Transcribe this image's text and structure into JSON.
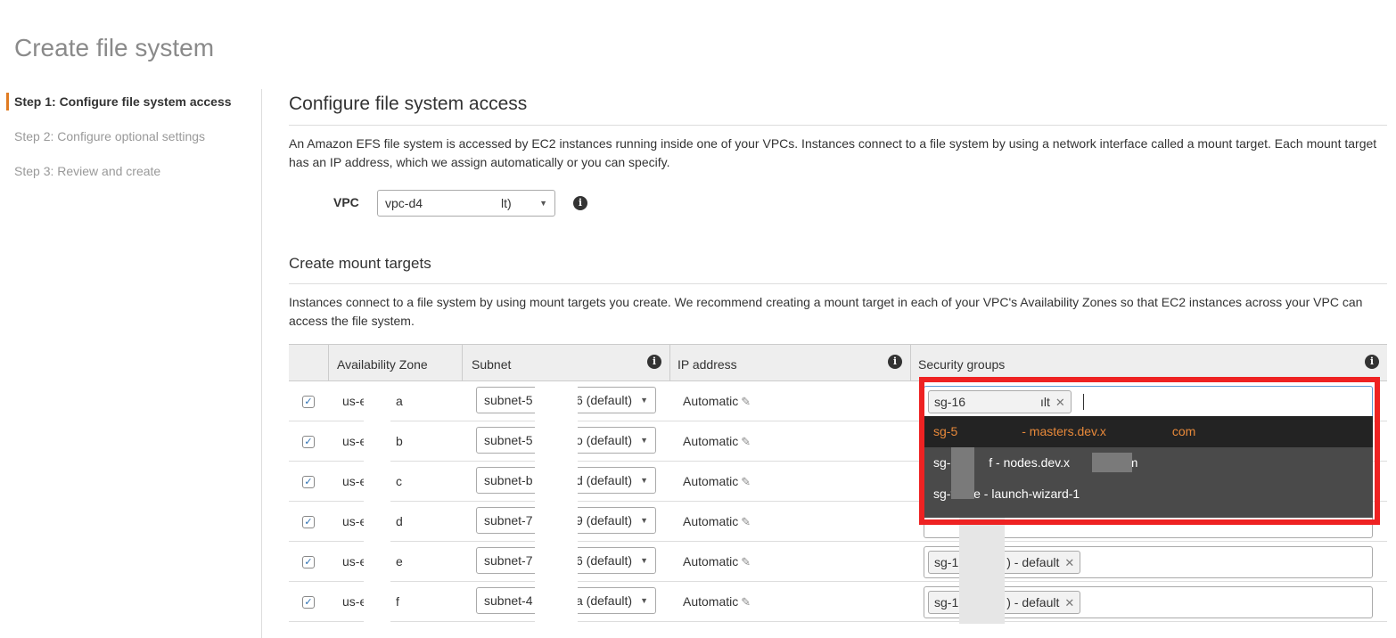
{
  "page_title": "Create file system",
  "steps": [
    {
      "label": "Step 1: Configure file system access",
      "active": true
    },
    {
      "label": "Step 2: Configure optional settings",
      "active": false
    },
    {
      "label": "Step 3: Review and create",
      "active": false
    }
  ],
  "section_title": "Configure file system access",
  "section_desc": "An Amazon EFS file system is accessed by EC2 instances running inside one of your VPCs. Instances connect to a file system by using a network interface called a mount target. Each mount target has an IP address, which we assign automatically or you can specify.",
  "vpc": {
    "label": "VPC",
    "value_start": "vpc-d4",
    "value_end": "lt)"
  },
  "mount_targets": {
    "title": "Create mount targets",
    "desc": "Instances connect to a file system by using mount targets you create. We recommend creating a mount target in each of your VPC's Availability Zones so that EC2 instances across your VPC can access the file system.",
    "columns": {
      "az": "Availability Zone",
      "subnet": "Subnet",
      "ip": "IP address",
      "sg": "Security groups"
    },
    "rows": [
      {
        "az": "us-e",
        "suffix": "a",
        "subnet_start": "subnet-5",
        "subnet_end": "6 (default)",
        "ip": "Automatic",
        "sg": "sg-16",
        "sg_end": "ılt"
      },
      {
        "az": "us-e",
        "suffix": "b",
        "subnet_start": "subnet-5",
        "subnet_end": "o (default)",
        "ip": "Automatic",
        "sg": "",
        "sg_end": ""
      },
      {
        "az": "us-e",
        "suffix": "c",
        "subnet_start": "subnet-b",
        "subnet_end": "d (default)",
        "ip": "Automatic",
        "sg": "",
        "sg_end": ""
      },
      {
        "az": "us-e",
        "suffix": "d",
        "subnet_start": "subnet-7",
        "subnet_end": "9 (default)",
        "ip": "Automatic",
        "sg": "",
        "sg_end": ""
      },
      {
        "az": "us-e",
        "suffix": "e",
        "subnet_start": "subnet-7",
        "subnet_end": "6 (default)",
        "ip": "Automatic",
        "sg": "sg-1",
        "sg_end": ") - default"
      },
      {
        "az": "us-e",
        "suffix": "f",
        "subnet_start": "subnet-4",
        "subnet_end": "a (default)",
        "ip": "Automatic",
        "sg": "sg-1",
        "sg_end": ") - default"
      }
    ]
  },
  "dropdown": {
    "items": [
      {
        "a": "sg-5",
        "b": "- masters.dev.x",
        "c": "com"
      },
      {
        "a": "sg-9",
        "b": "f - nodes.dev.x",
        "c": ".com"
      },
      {
        "a": "sg-f8",
        "b": "e - launch-wizard-1",
        "c": ""
      }
    ]
  },
  "icons": {
    "info": "info-icon",
    "pencil": "pencil-icon",
    "remove": "close-icon",
    "caret": "caret-down-icon",
    "check": "check-icon"
  },
  "colors": {
    "accent": "#e07b22",
    "highlight_frame": "#ee2222",
    "dropdown_bg": "#4a4a4a"
  }
}
